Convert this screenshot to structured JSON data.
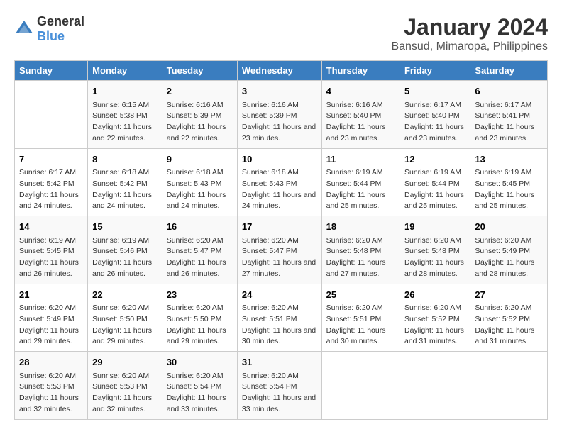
{
  "logo": {
    "text_general": "General",
    "text_blue": "Blue"
  },
  "title": "January 2024",
  "subtitle": "Bansud, Mimaropa, Philippines",
  "days_of_week": [
    "Sunday",
    "Monday",
    "Tuesday",
    "Wednesday",
    "Thursday",
    "Friday",
    "Saturday"
  ],
  "weeks": [
    [
      {
        "day": "",
        "sunrise": "",
        "sunset": "",
        "daylight": ""
      },
      {
        "day": "1",
        "sunrise": "Sunrise: 6:15 AM",
        "sunset": "Sunset: 5:38 PM",
        "daylight": "Daylight: 11 hours and 22 minutes."
      },
      {
        "day": "2",
        "sunrise": "Sunrise: 6:16 AM",
        "sunset": "Sunset: 5:39 PM",
        "daylight": "Daylight: 11 hours and 22 minutes."
      },
      {
        "day": "3",
        "sunrise": "Sunrise: 6:16 AM",
        "sunset": "Sunset: 5:39 PM",
        "daylight": "Daylight: 11 hours and 23 minutes."
      },
      {
        "day": "4",
        "sunrise": "Sunrise: 6:16 AM",
        "sunset": "Sunset: 5:40 PM",
        "daylight": "Daylight: 11 hours and 23 minutes."
      },
      {
        "day": "5",
        "sunrise": "Sunrise: 6:17 AM",
        "sunset": "Sunset: 5:40 PM",
        "daylight": "Daylight: 11 hours and 23 minutes."
      },
      {
        "day": "6",
        "sunrise": "Sunrise: 6:17 AM",
        "sunset": "Sunset: 5:41 PM",
        "daylight": "Daylight: 11 hours and 23 minutes."
      }
    ],
    [
      {
        "day": "7",
        "sunrise": "Sunrise: 6:17 AM",
        "sunset": "Sunset: 5:42 PM",
        "daylight": "Daylight: 11 hours and 24 minutes."
      },
      {
        "day": "8",
        "sunrise": "Sunrise: 6:18 AM",
        "sunset": "Sunset: 5:42 PM",
        "daylight": "Daylight: 11 hours and 24 minutes."
      },
      {
        "day": "9",
        "sunrise": "Sunrise: 6:18 AM",
        "sunset": "Sunset: 5:43 PM",
        "daylight": "Daylight: 11 hours and 24 minutes."
      },
      {
        "day": "10",
        "sunrise": "Sunrise: 6:18 AM",
        "sunset": "Sunset: 5:43 PM",
        "daylight": "Daylight: 11 hours and 24 minutes."
      },
      {
        "day": "11",
        "sunrise": "Sunrise: 6:19 AM",
        "sunset": "Sunset: 5:44 PM",
        "daylight": "Daylight: 11 hours and 25 minutes."
      },
      {
        "day": "12",
        "sunrise": "Sunrise: 6:19 AM",
        "sunset": "Sunset: 5:44 PM",
        "daylight": "Daylight: 11 hours and 25 minutes."
      },
      {
        "day": "13",
        "sunrise": "Sunrise: 6:19 AM",
        "sunset": "Sunset: 5:45 PM",
        "daylight": "Daylight: 11 hours and 25 minutes."
      }
    ],
    [
      {
        "day": "14",
        "sunrise": "Sunrise: 6:19 AM",
        "sunset": "Sunset: 5:45 PM",
        "daylight": "Daylight: 11 hours and 26 minutes."
      },
      {
        "day": "15",
        "sunrise": "Sunrise: 6:19 AM",
        "sunset": "Sunset: 5:46 PM",
        "daylight": "Daylight: 11 hours and 26 minutes."
      },
      {
        "day": "16",
        "sunrise": "Sunrise: 6:20 AM",
        "sunset": "Sunset: 5:47 PM",
        "daylight": "Daylight: 11 hours and 26 minutes."
      },
      {
        "day": "17",
        "sunrise": "Sunrise: 6:20 AM",
        "sunset": "Sunset: 5:47 PM",
        "daylight": "Daylight: 11 hours and 27 minutes."
      },
      {
        "day": "18",
        "sunrise": "Sunrise: 6:20 AM",
        "sunset": "Sunset: 5:48 PM",
        "daylight": "Daylight: 11 hours and 27 minutes."
      },
      {
        "day": "19",
        "sunrise": "Sunrise: 6:20 AM",
        "sunset": "Sunset: 5:48 PM",
        "daylight": "Daylight: 11 hours and 28 minutes."
      },
      {
        "day": "20",
        "sunrise": "Sunrise: 6:20 AM",
        "sunset": "Sunset: 5:49 PM",
        "daylight": "Daylight: 11 hours and 28 minutes."
      }
    ],
    [
      {
        "day": "21",
        "sunrise": "Sunrise: 6:20 AM",
        "sunset": "Sunset: 5:49 PM",
        "daylight": "Daylight: 11 hours and 29 minutes."
      },
      {
        "day": "22",
        "sunrise": "Sunrise: 6:20 AM",
        "sunset": "Sunset: 5:50 PM",
        "daylight": "Daylight: 11 hours and 29 minutes."
      },
      {
        "day": "23",
        "sunrise": "Sunrise: 6:20 AM",
        "sunset": "Sunset: 5:50 PM",
        "daylight": "Daylight: 11 hours and 29 minutes."
      },
      {
        "day": "24",
        "sunrise": "Sunrise: 6:20 AM",
        "sunset": "Sunset: 5:51 PM",
        "daylight": "Daylight: 11 hours and 30 minutes."
      },
      {
        "day": "25",
        "sunrise": "Sunrise: 6:20 AM",
        "sunset": "Sunset: 5:51 PM",
        "daylight": "Daylight: 11 hours and 30 minutes."
      },
      {
        "day": "26",
        "sunrise": "Sunrise: 6:20 AM",
        "sunset": "Sunset: 5:52 PM",
        "daylight": "Daylight: 11 hours and 31 minutes."
      },
      {
        "day": "27",
        "sunrise": "Sunrise: 6:20 AM",
        "sunset": "Sunset: 5:52 PM",
        "daylight": "Daylight: 11 hours and 31 minutes."
      }
    ],
    [
      {
        "day": "28",
        "sunrise": "Sunrise: 6:20 AM",
        "sunset": "Sunset: 5:53 PM",
        "daylight": "Daylight: 11 hours and 32 minutes."
      },
      {
        "day": "29",
        "sunrise": "Sunrise: 6:20 AM",
        "sunset": "Sunset: 5:53 PM",
        "daylight": "Daylight: 11 hours and 32 minutes."
      },
      {
        "day": "30",
        "sunrise": "Sunrise: 6:20 AM",
        "sunset": "Sunset: 5:54 PM",
        "daylight": "Daylight: 11 hours and 33 minutes."
      },
      {
        "day": "31",
        "sunrise": "Sunrise: 6:20 AM",
        "sunset": "Sunset: 5:54 PM",
        "daylight": "Daylight: 11 hours and 33 minutes."
      },
      {
        "day": "",
        "sunrise": "",
        "sunset": "",
        "daylight": ""
      },
      {
        "day": "",
        "sunrise": "",
        "sunset": "",
        "daylight": ""
      },
      {
        "day": "",
        "sunrise": "",
        "sunset": "",
        "daylight": ""
      }
    ]
  ]
}
